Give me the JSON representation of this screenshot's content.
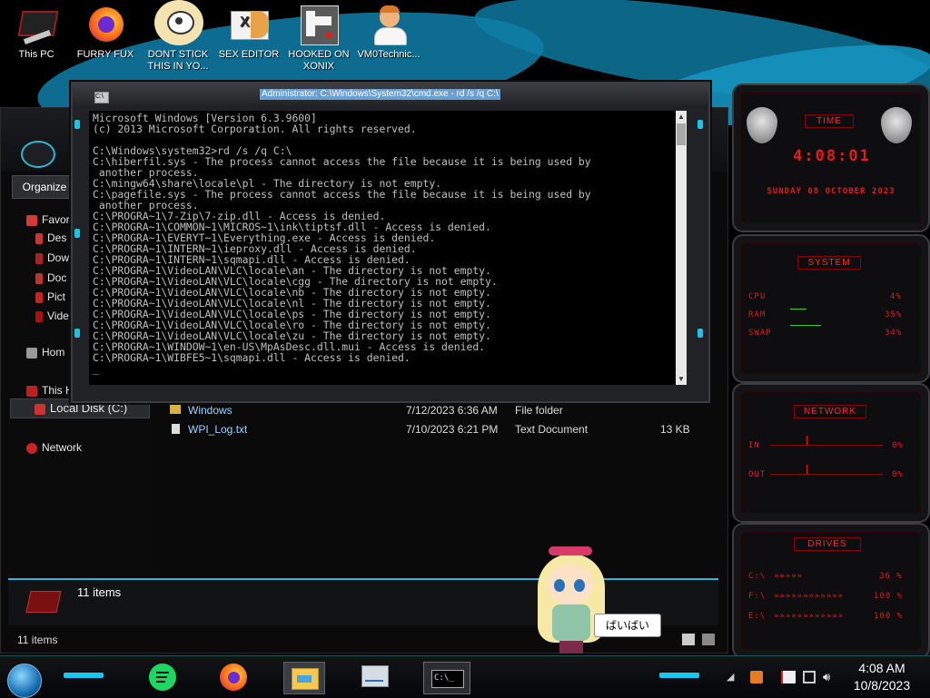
{
  "desktop": {
    "icons": [
      {
        "label": "This PC",
        "icon": "computer-icon"
      },
      {
        "label": "FURRY FUX",
        "icon": "firefox-icon"
      },
      {
        "label": "DONT STICK THIS IN YO...",
        "icon": "cartoon-icon"
      },
      {
        "label": "SEX EDITOR",
        "icon": "hex-editor-icon"
      },
      {
        "label": "HOOKED ON XONIX",
        "icon": "xonix-game-icon"
      },
      {
        "label": "VM0Technic...",
        "icon": "doctor-icon"
      }
    ]
  },
  "cmd": {
    "title": "Administrator: C:\\Windows\\System32\\cmd.exe - rd  /s /q C:\\",
    "icon_text": "C:\\",
    "lines": [
      "Microsoft Windows [Version 6.3.9600]",
      "(c) 2013 Microsoft Corporation. All rights reserved.",
      "",
      "C:\\Windows\\system32>rd /s /q C:\\",
      "C:\\hiberfil.sys - The process cannot access the file because it is being used by",
      " another process.",
      "C:\\mingw64\\share\\locale\\pl - The directory is not empty.",
      "C:\\pagefile.sys - The process cannot access the file because it is being used by",
      " another process.",
      "C:\\PROGRA~1\\7-Zip\\7-zip.dll - Access is denied.",
      "C:\\PROGRA~1\\COMMON~1\\MICROS~1\\ink\\tiptsf.dll - Access is denied.",
      "C:\\PROGRA~1\\EVERYT~1\\Everything.exe - Access is denied.",
      "C:\\PROGRA~1\\INTERN~1\\ieproxy.dll - Access is denied.",
      "C:\\PROGRA~1\\INTERN~1\\sqmapi.dll - Access is denied.",
      "C:\\PROGRA~1\\VideoLAN\\VLC\\locale\\an - The directory is not empty.",
      "C:\\PROGRA~1\\VideoLAN\\VLC\\locale\\cgg - The directory is not empty.",
      "C:\\PROGRA~1\\VideoLAN\\VLC\\locale\\nb - The directory is not empty.",
      "C:\\PROGRA~1\\VideoLAN\\VLC\\locale\\nl - The directory is not empty.",
      "C:\\PROGRA~1\\VideoLAN\\VLC\\locale\\ps - The directory is not empty.",
      "C:\\PROGRA~1\\VideoLAN\\VLC\\locale\\ro - The directory is not empty.",
      "C:\\PROGRA~1\\VideoLAN\\VLC\\locale\\zu - The directory is not empty.",
      "C:\\PROGRA~1\\WINDOW~1\\en-US\\MpAsDesc.dll.mui - Access is denied.",
      "C:\\PROGRA~1\\WIBFE5~1\\sqmapi.dll - Access is denied.",
      "_"
    ]
  },
  "explorer": {
    "organize_label": "Organize",
    "nav": {
      "favorites": "Favor",
      "desktop": "Des",
      "downloads": "Dow",
      "documents": "Doc",
      "pictures": "Pict",
      "videos": "Vide",
      "homegroup": "Hom",
      "this_pc": "This H",
      "local_disk": "Local Disk (C:)",
      "network": "Network"
    },
    "files": [
      {
        "name": "Windows",
        "date": "7/12/2023 6:36 AM",
        "type": "File folder",
        "size": ""
      },
      {
        "name": "WPI_Log.txt",
        "date": "7/10/2023 6:21 PM",
        "type": "Text Document",
        "size": "13 KB"
      }
    ],
    "details_count": "11 items",
    "status_count": "11 items"
  },
  "gadget": {
    "time_title": "TIME",
    "time": "4:08:01",
    "date": "SUNDAY 08 OCTOBER 2023",
    "system_title": "SYSTEM",
    "cpu_label": "CPU",
    "cpu_value": "4%",
    "ram_label": "RAM",
    "ram_value": "35%",
    "swap_label": "SWAP",
    "swap_value": "34%",
    "network_title": "NETWORK",
    "in_label": "IN",
    "in_value": "0%",
    "out_label": "OUT",
    "out_value": "0%",
    "drives_title": "DRIVES",
    "drives": [
      {
        "label": "C:\\",
        "value": "36 %"
      },
      {
        "label": "F:\\",
        "value": "100 %"
      },
      {
        "label": "E:\\",
        "value": "100 %"
      }
    ],
    "accent": "#e21b1b"
  },
  "mascot": {
    "speech": "ばいばい"
  },
  "taskbar": {
    "apps": [
      "spotify-icon",
      "firefox-icon",
      "file-explorer-icon",
      "performance-monitor-icon",
      "cmd-icon"
    ],
    "cmd_label": "C:\\_",
    "time": "4:08 AM",
    "date": "10/8/2023"
  }
}
